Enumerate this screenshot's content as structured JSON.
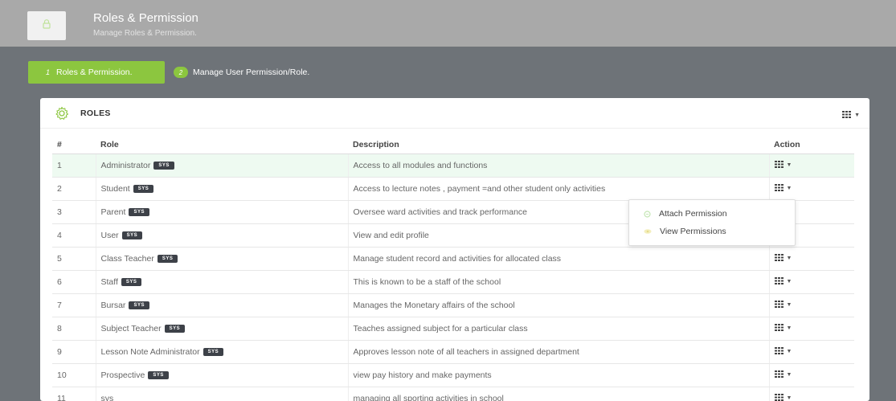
{
  "header": {
    "title": "Roles & Permission",
    "subtitle": "Manage Roles & Permission.",
    "icon": "lock-icon"
  },
  "steps": [
    {
      "number": "1",
      "label": "Roles & Permission.",
      "active": true
    },
    {
      "number": "2",
      "label": "Manage User Permission/Role.",
      "active": false
    }
  ],
  "card": {
    "title": "ROLES",
    "title_icon": "gear-icon",
    "toolbar_icon": "grid-icon"
  },
  "table": {
    "headers": [
      "#",
      "Role",
      "Description",
      "Action"
    ],
    "rows": [
      {
        "num": "1",
        "role": "Administrator",
        "badge": "SYS",
        "description": "Access to all modules and functions"
      },
      {
        "num": "2",
        "role": "Student",
        "badge": "SYS",
        "description": "Access to lecture notes , payment =and other student only activities"
      },
      {
        "num": "3",
        "role": "Parent",
        "badge": "SYS",
        "description": "Oversee ward activities and track performance"
      },
      {
        "num": "4",
        "role": "User",
        "badge": "SYS",
        "description": "View and edit profile"
      },
      {
        "num": "5",
        "role": "Class Teacher",
        "badge": "SYS",
        "description": "Manage student record and activities for allocated class"
      },
      {
        "num": "6",
        "role": "Staff",
        "badge": "SYS",
        "description": "This is known to be a staff of the school"
      },
      {
        "num": "7",
        "role": "Bursar",
        "badge": "SYS",
        "description": "Manages the Monetary affairs of the school"
      },
      {
        "num": "8",
        "role": "Subject Teacher",
        "badge": "SYS",
        "description": "Teaches assigned subject for a particular class"
      },
      {
        "num": "9",
        "role": "Lesson Note Administrator",
        "badge": "SYS",
        "description": "Approves lesson note of all teachers in assigned department"
      },
      {
        "num": "10",
        "role": "Prospective",
        "badge": "SYS",
        "description": "view pay history and make payments"
      },
      {
        "num": "11",
        "role": "sys",
        "badge": "",
        "description": "managing all sporting activities in school"
      }
    ]
  },
  "dropdown": {
    "items": [
      "Attach Permission",
      "View Permissions"
    ]
  },
  "colors": {
    "accent_green": "#8cc63f",
    "header_gray": "#a9a9a9",
    "badge_dark": "#3d4148",
    "highlight_row": "#eefaf1"
  }
}
